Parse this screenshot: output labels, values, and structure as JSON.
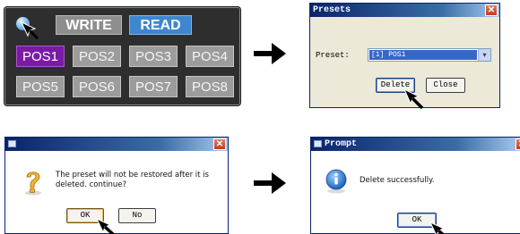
{
  "controller": {
    "write_label": "WRITE",
    "read_label": "READ",
    "positions": [
      "POS1",
      "POS2",
      "POS3",
      "POS4",
      "POS5",
      "POS6",
      "POS7",
      "POS8"
    ],
    "selected": "POS1"
  },
  "presets_dialog": {
    "title": "Presets",
    "preset_label": "Preset:",
    "preset_value": "[1] POS1",
    "delete_label": "Delete",
    "close_label": "Close"
  },
  "confirm_dialog": {
    "message": "The preset will not be restored after it is deleted. continue?",
    "ok_label": "OK",
    "no_label": "No"
  },
  "prompt_dialog": {
    "title": "Prompt",
    "message": "Delete successfully.",
    "ok_label": "OK"
  },
  "colors": {
    "selected_preset": "#7b1ba5",
    "read_button": "#3e86cf",
    "window_title": "#0a246a"
  }
}
